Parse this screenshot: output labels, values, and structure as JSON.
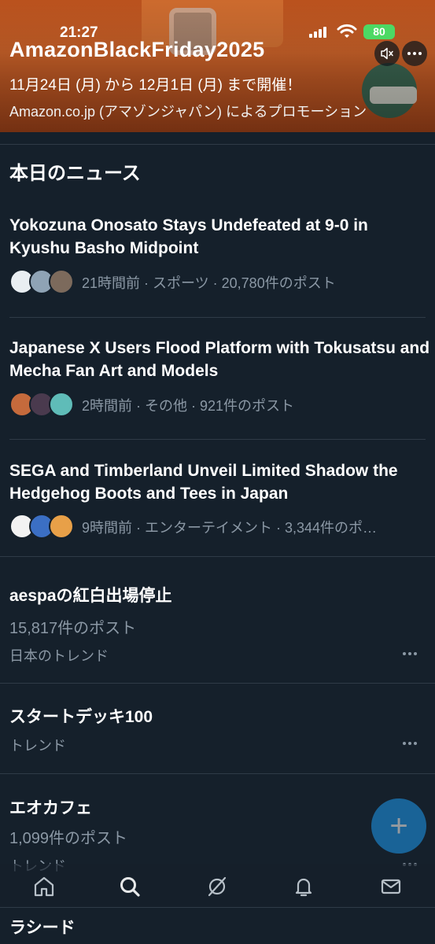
{
  "status_bar": {
    "time": "21:27",
    "battery": "80"
  },
  "promo": {
    "title": "AmazonBlackFriday2025",
    "subtitle": "11月24日 (月) から 12月1日 (月) まで開催！",
    "source": "Amazon.co.jp (アマゾンジャパン) によるプロモーション"
  },
  "news_section": {
    "title": "本日のニュース",
    "items": [
      {
        "headline": "Yokozuna Onosato Stays Undefeated at 9-0 in Kyushu Basho Midpoint",
        "meta": "21時間前 · スポーツ · 20,780件のポスト"
      },
      {
        "headline": "Japanese X Users Flood Platform with Tokusatsu and Mecha Fan Art and Models",
        "meta": "2時間前 · その他 · 921件のポスト"
      },
      {
        "headline": "SEGA and Timberland Unveil Limited Shadow the Hedgehog Boots and Tees in Japan",
        "meta": "9時間前 · エンターテイメント · 3,344件のポ…"
      }
    ]
  },
  "trends": [
    {
      "title": "aespaの紅白出場停止",
      "count": "15,817件のポスト",
      "context": "日本のトレンド"
    },
    {
      "title": "スタートデッキ100",
      "context": "トレンド"
    },
    {
      "title": "エオカフェ",
      "count": "1,099件のポスト",
      "context": "トレンド"
    },
    {
      "title": "ラシード"
    }
  ],
  "colors": {
    "background": "#15202b",
    "accent": "#1d9bf0",
    "muted": "#8b98a5"
  },
  "icons": {
    "nav": [
      "home-icon",
      "search-icon",
      "grok-icon",
      "notifications-icon",
      "messages-icon"
    ],
    "fab": "plus-icon"
  }
}
